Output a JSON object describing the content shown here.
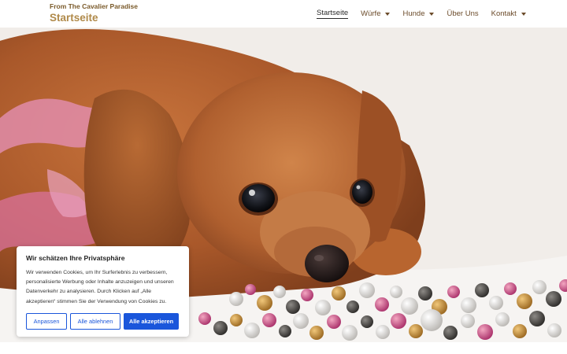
{
  "header": {
    "site_name": "From The Cavalier Paradise",
    "page_title": "Startseite"
  },
  "nav": {
    "items": [
      {
        "label": "Startseite",
        "active": true,
        "dropdown": false
      },
      {
        "label": "Würfe",
        "active": false,
        "dropdown": true
      },
      {
        "label": "Hunde",
        "active": false,
        "dropdown": true
      },
      {
        "label": "Über Uns",
        "active": false,
        "dropdown": false
      },
      {
        "label": "Kontakt",
        "active": false,
        "dropdown": true
      }
    ]
  },
  "hero": {
    "image_subject": "cavalier-king-charles-puppy-with-pearls"
  },
  "cookie_banner": {
    "title": "Wir schätzen Ihre Privatsphäre",
    "text": "Wir verwenden Cookies, um Ihr Surferlebnis zu verbessern, personalisierte Werbung oder Inhalte anzuzeigen und unseren Datenverkehr zu analysieren. Durch Klicken auf „Alle akzeptieren“ stimmen Sie der Verwendung von Cookies zu.",
    "buttons": {
      "customize": "Anpassen",
      "reject_all": "Alle ablehnen",
      "accept_all": "Alle akzeptieren"
    }
  },
  "colors": {
    "accent_blue": "#1a56db",
    "brand_brown": "#7a5a2a",
    "title_gold": "#b08a4a"
  }
}
